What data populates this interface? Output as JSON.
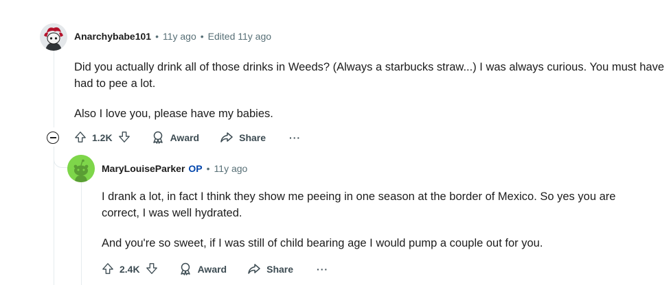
{
  "comment": {
    "author": "Anarchybabe101",
    "timestamp": "11y ago",
    "edited": "Edited 11y ago",
    "paragraphs": [
      "Did you actually drink all of those drinks in Weeds? (Always a starbucks straw...) I was always curious. You must have had to pee a lot.",
      "Also I love you, please have my babies."
    ],
    "votes": "1.2K",
    "award_label": "Award",
    "share_label": "Share",
    "more_label": "···"
  },
  "reply": {
    "author": "MaryLouiseParker",
    "op_tag": "OP",
    "timestamp": "11y ago",
    "paragraphs": [
      "I drank a lot, in fact I think they show me peeing in one season at the border of Mexico. So yes you are correct, I was well hydrated.",
      "And you're so sweet, if I was still of child bearing age I would pump a couple out for you."
    ],
    "votes": "2.4K",
    "award_label": "Award",
    "share_label": "Share",
    "more_label": "···"
  },
  "colors": {
    "accent_op": "#0045ac",
    "muted": "#576f76",
    "thread_line": "#e5ebee",
    "reply_avatar_bg": "#7ed64a"
  },
  "icons": [
    "upvote-icon",
    "downvote-icon",
    "award-icon",
    "share-icon",
    "collapse-icon"
  ]
}
